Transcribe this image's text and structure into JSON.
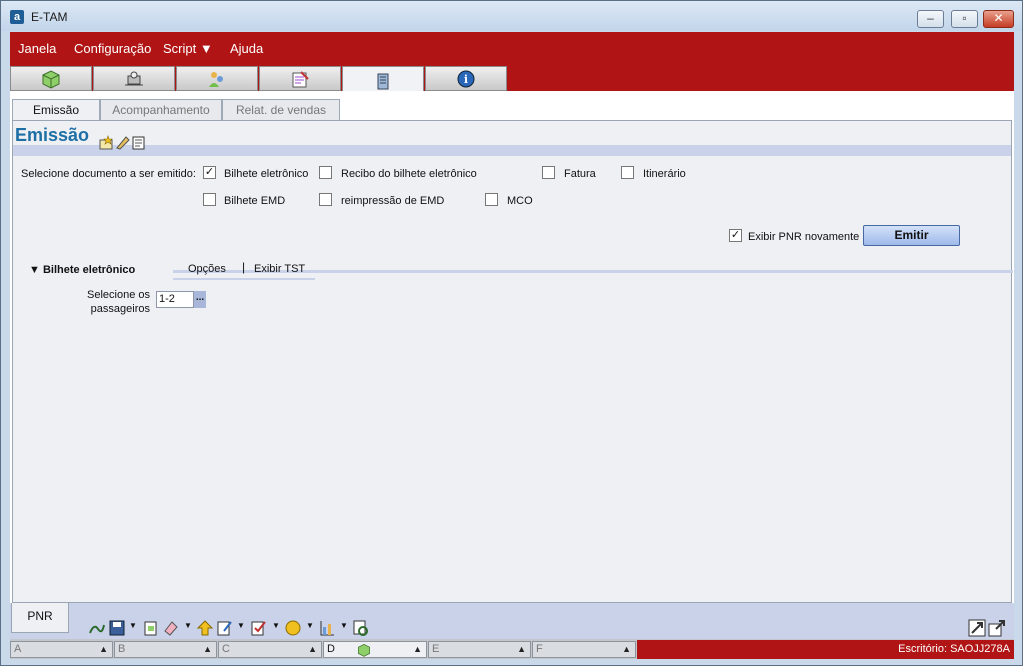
{
  "window": {
    "title": "E-TAM",
    "app_icon": "a"
  },
  "menu": [
    {
      "label": "Janela"
    },
    {
      "label": "Configuração"
    },
    {
      "label": "Script ▼"
    },
    {
      "label": "Ajuda"
    }
  ],
  "toolbar_tabs": [
    "cube-icon",
    "machine-icon",
    "people-icon",
    "notes-icon",
    "building-icon",
    "info-icon"
  ],
  "subtabs": [
    "Emissão",
    "Acompanhamento",
    "Relat. de vendas"
  ],
  "page": {
    "title": "Emissão"
  },
  "doc_select": {
    "label": "Selecione documento a ser emitido:",
    "options": [
      {
        "label": "Bilhete eletrônico",
        "checked": true
      },
      {
        "label": "Recibo do bilhete eletrônico",
        "checked": false
      },
      {
        "label": "Fatura",
        "checked": false
      },
      {
        "label": "Itinerário",
        "checked": false
      },
      {
        "label": "Bilhete EMD",
        "checked": false
      },
      {
        "label": "reimpressão de EMD",
        "checked": false
      },
      {
        "label": "MCO",
        "checked": false
      }
    ]
  },
  "pnr_again": {
    "label": "Exibir PNR novamente",
    "checked": true
  },
  "emit_button": "Emitir",
  "section": {
    "title": "Bilhete eletrônico",
    "tabs": [
      "Opções",
      "Exibir TST"
    ]
  },
  "passengers": {
    "label_line1": "Selecione os",
    "label_line2": "passageiros",
    "value": "1-2",
    "button": "..."
  },
  "bottom": {
    "pnr_tab": "PNR"
  },
  "status": {
    "cells": [
      "A",
      "B",
      "C",
      "D",
      "E",
      "F"
    ],
    "office": "Escritório: SAOJJ278A"
  },
  "colors": {
    "brand_red": "#b01414",
    "title_blue": "#1d6fa5",
    "band": "#c9d2e8"
  }
}
